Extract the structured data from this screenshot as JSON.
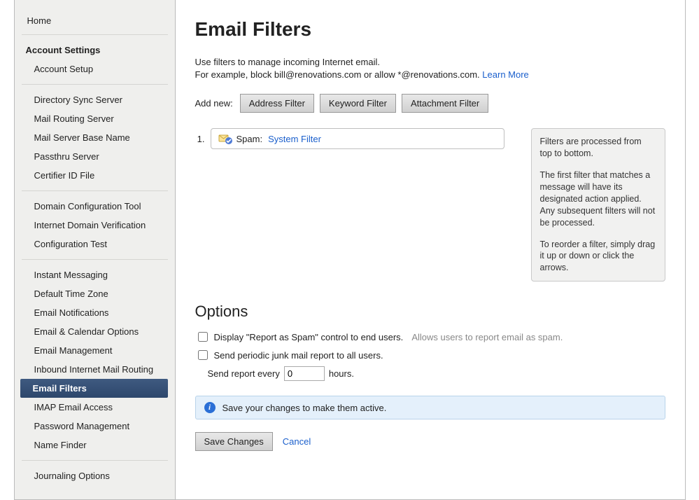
{
  "sidebar": {
    "home": "Home",
    "section_title": "Account Settings",
    "groups": [
      [
        "Account Setup"
      ],
      [
        "Directory Sync Server",
        "Mail Routing Server",
        "Mail Server Base Name",
        "Passthru Server",
        "Certifier ID File"
      ],
      [
        "Domain Configuration Tool",
        "Internet Domain Verification",
        "Configuration Test"
      ],
      [
        "Instant Messaging",
        "Default Time Zone",
        "Email Notifications",
        "Email & Calendar Options",
        "Email Management",
        "Inbound Internet Mail Routing",
        "Email Filters",
        "IMAP Email Access",
        "Password Management",
        "Name Finder"
      ],
      [
        "Journaling Options"
      ]
    ],
    "active": "Email Filters"
  },
  "page": {
    "title": "Email Filters",
    "desc_line1": "Use filters to manage incoming Internet email.",
    "desc_line2": "For example, block bill@renovations.com or allow *@renovations.com.",
    "learn_more": "Learn More",
    "add_new_label": "Add new:",
    "buttons": {
      "address": "Address Filter",
      "keyword": "Keyword Filter",
      "attachment": "Attachment Filter"
    },
    "filters": [
      {
        "num": "1.",
        "label": "Spam:",
        "link": "System Filter"
      }
    ],
    "info": {
      "p1": "Filters are processed from top to bottom.",
      "p2": "The first filter that matches a message will have its designated action applied. Any subsequent filters will not be processed.",
      "p3": "To reorder a filter, simply drag it up or down or click the arrows."
    },
    "options": {
      "heading": "Options",
      "display_spam_label": "Display \"Report as Spam\" control to end users.",
      "display_spam_hint": "Allows users to report email as spam.",
      "periodic_label": "Send periodic junk mail report to all users.",
      "send_every_pre": "Send report every",
      "send_every_value": "0",
      "send_every_post": "hours."
    },
    "notice": "Save your changes to make them active.",
    "actions": {
      "save": "Save Changes",
      "cancel": "Cancel"
    }
  }
}
